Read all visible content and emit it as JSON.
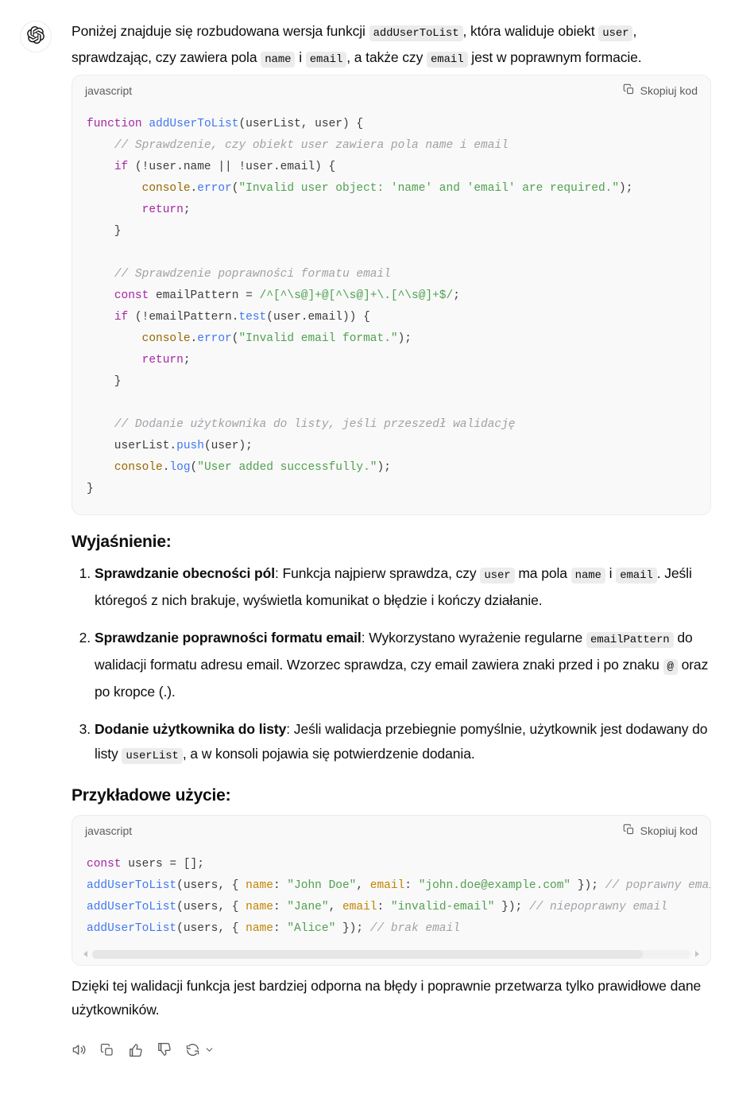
{
  "avatar": {
    "icon": "openai-logo-icon"
  },
  "intro": {
    "seg1": "Poniżej znajduje się rozbudowana wersja funkcji ",
    "code1": "addUserToList",
    "seg2": ", która waliduje obiekt ",
    "code2": "user",
    "seg3": ", sprawdzając, czy zawiera pola ",
    "code3": "name",
    "seg4": " i ",
    "code4": "email",
    "seg5": ", a także czy ",
    "code5": "email",
    "seg6": " jest w poprawnym formacie."
  },
  "code_block_1": {
    "language": "javascript",
    "copy_label": "Skopiuj kod",
    "copy_icon": "copy-icon",
    "lines": [
      "function addUserToList(userList, user) {",
      "    // Sprawdzenie, czy obiekt user zawiera pola name i email",
      "    if (!user.name || !user.email) {",
      "        console.error(\"Invalid user object: 'name' and 'email' are required.\");",
      "        return;",
      "    }",
      "",
      "    // Sprawdzenie poprawności formatu email",
      "    const emailPattern = /^[^\\s@]+@[^\\s@]+\\.[^\\s@]+$/;",
      "    if (!emailPattern.test(user.email)) {",
      "        console.error(\"Invalid email format.\");",
      "        return;",
      "    }",
      "",
      "    // Dodanie użytkownika do listy, jeśli przeszedł walidację",
      "    userList.push(user);",
      "    console.log(\"User added successfully.\");",
      "}"
    ]
  },
  "explanation": {
    "heading": "Wyjaśnienie:",
    "items": [
      {
        "title": "Sprawdzanie obecności pól",
        "seg1": ": Funkcja najpierw sprawdza, czy ",
        "code1": "user",
        "seg2": " ma pola ",
        "code2": "name",
        "seg3": " i ",
        "code3": "email",
        "seg4": ". Jeśli któregoś z nich brakuje, wyświetla komunikat o błędzie i kończy działanie."
      },
      {
        "title": "Sprawdzanie poprawności formatu email",
        "seg1": ": Wykorzystano wyrażenie regularne ",
        "code1": "emailPattern",
        "seg2": " do walidacji formatu adresu email. Wzorzec sprawdza, czy email zawiera znaki przed i po znaku ",
        "code2": "@",
        "seg3": " oraz po kropce (.).",
        "code3": "",
        "seg4": ""
      },
      {
        "title": "Dodanie użytkownika do listy",
        "seg1": ": Jeśli walidacja przebiegnie pomyślnie, użytkownik jest dodawany do listy ",
        "code1": "userList",
        "seg2": ", a w konsoli pojawia się potwierdzenie dodania.",
        "code2": "",
        "seg3": "",
        "code3": "",
        "seg4": ""
      }
    ]
  },
  "example": {
    "heading": "Przykładowe użycie:",
    "language": "javascript",
    "copy_label": "Skopiuj kod",
    "copy_icon": "copy-icon",
    "lines": [
      "const users = [];",
      "addUserToList(users, { name: \"John Doe\", email: \"john.doe@example.com\" }); // poprawny email",
      "addUserToList(users, { name: \"Jane\", email: \"invalid-email\" }); // niepoprawny email",
      "addUserToList(users, { name: \"Alice\" }); // brak email"
    ],
    "scrollbar": {
      "left_arrow": "chevron-left-icon",
      "right_arrow": "chevron-right-icon"
    }
  },
  "closing": {
    "text": "Dzięki tej walidacji funkcja jest bardziej odporna na błędy i poprawnie przetwarza tylko prawidłowe dane użytkowników."
  },
  "actions": [
    {
      "name": "read-aloud-button",
      "icon": "speaker-icon"
    },
    {
      "name": "copy-message-button",
      "icon": "copy-icon"
    },
    {
      "name": "thumbs-up-button",
      "icon": "thumbs-up-icon"
    },
    {
      "name": "thumbs-down-button",
      "icon": "thumbs-down-icon"
    },
    {
      "name": "regenerate-button",
      "icon": "refresh-icon"
    },
    {
      "name": "regenerate-dropdown",
      "icon": "chevron-down-icon"
    }
  ],
  "colors": {
    "code_bg": "#f9f9f9",
    "inline_code_bg": "#ececec",
    "text": "#0d0d0d",
    "muted": "#5d5d5d",
    "keyword": "#a626a4",
    "function": "#4078f2",
    "string": "#50a14f",
    "comment": "#a0a1a7",
    "object": "#986801",
    "key": "#c18401"
  }
}
